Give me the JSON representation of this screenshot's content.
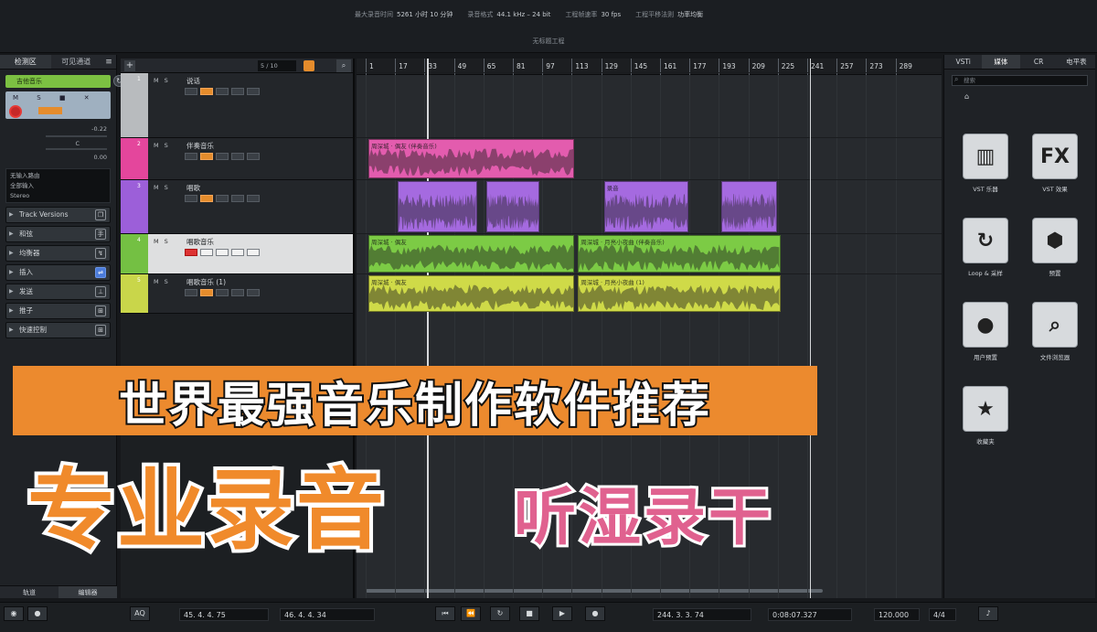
{
  "topbar": {
    "stats": [
      {
        "label": "最大录音时间",
        "value": "5261 小时 10 分钟"
      },
      {
        "label": "录音格式",
        "value": "44.1 kHz – 24 bit"
      },
      {
        "label": "工程帧速率",
        "value": "30 fps"
      },
      {
        "label": "工程平移法则",
        "value": "功率均衡"
      }
    ],
    "project_name": "无标题工程"
  },
  "inspector": {
    "tabs": [
      "检测区",
      "可见通道"
    ],
    "menu": "≡",
    "track_name": "吉他音乐",
    "track_cycle_icon": "↻",
    "button_row": "M S ■ ✕",
    "volume_value": "-0.22",
    "pan_value": "C",
    "zero_value": "0.00",
    "routing": [
      "无输入路由",
      "全部输入",
      "Stereo"
    ],
    "sections": [
      {
        "label": "Track Versions",
        "icon": "❐",
        "blue": false
      },
      {
        "label": "和弦",
        "icon": "手",
        "blue": false
      },
      {
        "label": "均衡器",
        "icon": "↯",
        "blue": false
      },
      {
        "label": "插入",
        "icon": "⇌",
        "blue": true
      },
      {
        "label": "发送",
        "icon": "⊥",
        "blue": false
      },
      {
        "label": "推子",
        "icon": "⊞",
        "blue": false
      },
      {
        "label": "快速控制",
        "icon": "⊞",
        "blue": false
      }
    ],
    "bottom_tabs": [
      "轨道",
      "编辑器"
    ]
  },
  "tracklist": {
    "add": "+",
    "count": "5 / 10",
    "search_icon": "⌕",
    "tracks": [
      {
        "num": "1",
        "name": "说话",
        "color": "#b8bbbe",
        "selected": false
      },
      {
        "num": "2",
        "name": "伴奏音乐",
        "color": "#e4469c",
        "selected": false
      },
      {
        "num": "3",
        "name": "唱歌",
        "color": "#9c5fd9",
        "selected": false
      },
      {
        "num": "4",
        "name": "唱歌音乐",
        "color": "#74c043",
        "selected": true
      },
      {
        "num": "5",
        "name": "唱歌音乐 (1)",
        "color": "#c9d64a",
        "selected": false
      }
    ]
  },
  "ruler": {
    "ticks": [
      "1",
      "17",
      "33",
      "49",
      "65",
      "81",
      "97",
      "113",
      "129",
      "145",
      "161",
      "177",
      "193",
      "209",
      "225",
      "241",
      "257",
      "273",
      "289"
    ]
  },
  "clips": [
    {
      "lane": 1,
      "label": "周深城 · 偶友 (伴奏音乐)",
      "color": "#e35cae",
      "start": 1,
      "end": 113
    },
    {
      "lane": 2,
      "label": "",
      "color": "#a56ae0",
      "start": 17,
      "end": 60
    },
    {
      "lane": 2,
      "label": "",
      "color": "#a56ae0",
      "start": 65,
      "end": 94
    },
    {
      "lane": 2,
      "label": "录音",
      "color": "#a56ae0",
      "start": 129,
      "end": 175
    },
    {
      "lane": 2,
      "label": "",
      "color": "#a56ae0",
      "start": 193,
      "end": 223
    },
    {
      "lane": 3,
      "label": "周深城 · 偶友",
      "color": "#7ccb45",
      "start": 1,
      "end": 113
    },
    {
      "lane": 3,
      "label": "周深城 · 月亮小夜曲 (伴奏音乐)",
      "color": "#7ccb45",
      "start": 115,
      "end": 225
    },
    {
      "lane": 4,
      "label": "周深城 · 偶友",
      "color": "#cfda48",
      "start": 1,
      "end": 113
    },
    {
      "lane": 4,
      "label": "周深城 · 月亮小夜曲 (1)",
      "color": "#cfda48",
      "start": 115,
      "end": 225
    }
  ],
  "media": {
    "tabs": [
      "VSTi",
      "媒体",
      "CR",
      "电平表"
    ],
    "search_placeholder": "搜索",
    "home": "⌂",
    "tiles": [
      {
        "glyph": "▥",
        "caption": "VST 乐器",
        "icon": "piano-keys-icon"
      },
      {
        "glyph": "FX",
        "caption": "VST 效果",
        "icon": "fx-icon"
      },
      {
        "glyph": "↻",
        "caption": "Loop & 采样",
        "icon": "loop-icon"
      },
      {
        "glyph": "⬢",
        "caption": "预置",
        "icon": "hexagon-icon"
      },
      {
        "glyph": "●",
        "caption": "用户预置",
        "icon": "user-preset-icon"
      },
      {
        "glyph": "⌕",
        "caption": "文件浏览器",
        "icon": "file-browser-icon"
      },
      {
        "glyph": "★",
        "caption": "收藏夹",
        "icon": "star-icon"
      }
    ]
  },
  "transport": {
    "left_locator": "45. 4. 4. 75",
    "right_locator": "46. 4. 4. 34",
    "position": "244. 3. 3. 74",
    "time": "0:08:07.327",
    "tempo": "120.000",
    "signature": "4/4"
  },
  "overlay": {
    "headline": "世界最强音乐制作软件推荐",
    "big_text": "专业录音",
    "pink_text": "听湿录干"
  }
}
